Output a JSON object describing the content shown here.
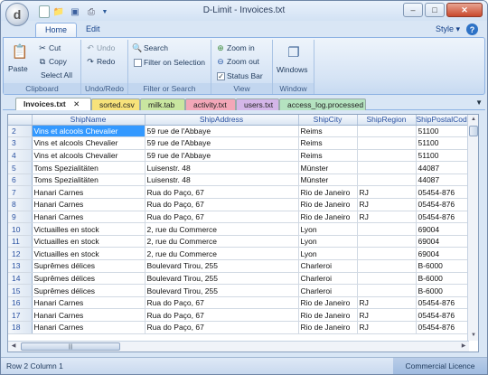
{
  "app": {
    "logo_letter": "d",
    "title": "D-Limit - Invoices.txt"
  },
  "window_controls": {
    "minimize": "–",
    "maximize": "□",
    "close": "✕"
  },
  "ribbon_tabs": {
    "home": "Home",
    "edit": "Edit",
    "style_menu": "Style ▾",
    "help": "?"
  },
  "ribbon": {
    "clipboard": {
      "paste": "Paste",
      "cut": "Cut",
      "copy": "Copy",
      "select_all": "Select All",
      "caption": "Clipboard"
    },
    "undo_redo": {
      "undo": "Undo",
      "redo": "Redo",
      "caption": "Undo/Redo"
    },
    "filter_search": {
      "search": "Search",
      "filter_on_selection": "Filter on Selection",
      "caption": "Filter or Search"
    },
    "view": {
      "zoom_in": "Zoom in",
      "zoom_out": "Zoom out",
      "status_bar": "Status Bar",
      "caption": "View"
    },
    "window": {
      "windows": "Windows",
      "caption": "Window"
    }
  },
  "document_tabs": [
    {
      "label": "Invoices.txt",
      "color": "#ffffff"
    },
    {
      "label": "sorted.csv",
      "color": "#f7e27a"
    },
    {
      "label": "milk.tab",
      "color": "#c9e6a0"
    },
    {
      "label": "activity.txt",
      "color": "#f3a7b8"
    },
    {
      "label": "users.txt",
      "color": "#d4b6e8"
    },
    {
      "label": "access_log.processed",
      "color": "#b5e3c0"
    }
  ],
  "tab_close": "✕",
  "grid": {
    "columns": [
      "ShipName",
      "ShipAddress",
      "ShipCity",
      "ShipRegion",
      "ShipPostalCode"
    ],
    "rows": [
      {
        "n": "2",
        "cells": [
          "Vins et alcools Chevalier",
          "59 rue de l'Abbaye",
          "Reims",
          "",
          "51100"
        ]
      },
      {
        "n": "3",
        "cells": [
          "Vins et alcools Chevalier",
          "59 rue de l'Abbaye",
          "Reims",
          "",
          "51100"
        ]
      },
      {
        "n": "4",
        "cells": [
          "Vins et alcools Chevalier",
          "59 rue de l'Abbaye",
          "Reims",
          "",
          "51100"
        ]
      },
      {
        "n": "5",
        "cells": [
          "Toms Spezialitäten",
          "Luisenstr. 48",
          "Münster",
          "",
          "44087"
        ]
      },
      {
        "n": "6",
        "cells": [
          "Toms Spezialitäten",
          "Luisenstr. 48",
          "Münster",
          "",
          "44087"
        ]
      },
      {
        "n": "7",
        "cells": [
          "Hanari Carnes",
          "Rua do Paço, 67",
          "Rio de Janeiro",
          "RJ",
          "05454-876"
        ]
      },
      {
        "n": "8",
        "cells": [
          "Hanari Carnes",
          "Rua do Paço, 67",
          "Rio de Janeiro",
          "RJ",
          "05454-876"
        ]
      },
      {
        "n": "9",
        "cells": [
          "Hanari Carnes",
          "Rua do Paço, 67",
          "Rio de Janeiro",
          "RJ",
          "05454-876"
        ]
      },
      {
        "n": "10",
        "cells": [
          "Victuailles en stock",
          "2, rue du Commerce",
          "Lyon",
          "",
          "69004"
        ]
      },
      {
        "n": "11",
        "cells": [
          "Victuailles en stock",
          "2, rue du Commerce",
          "Lyon",
          "",
          "69004"
        ]
      },
      {
        "n": "12",
        "cells": [
          "Victuailles en stock",
          "2, rue du Commerce",
          "Lyon",
          "",
          "69004"
        ]
      },
      {
        "n": "13",
        "cells": [
          "Suprêmes délices",
          "Boulevard Tirou, 255",
          "Charleroi",
          "",
          "B-6000"
        ]
      },
      {
        "n": "14",
        "cells": [
          "Suprêmes délices",
          "Boulevard Tirou, 255",
          "Charleroi",
          "",
          "B-6000"
        ]
      },
      {
        "n": "15",
        "cells": [
          "Suprêmes délices",
          "Boulevard Tirou, 255",
          "Charleroi",
          "",
          "B-6000"
        ]
      },
      {
        "n": "16",
        "cells": [
          "Hanari Carnes",
          "Rua do Paço, 67",
          "Rio de Janeiro",
          "RJ",
          "05454-876"
        ]
      },
      {
        "n": "17",
        "cells": [
          "Hanari Carnes",
          "Rua do Paço, 67",
          "Rio de Janeiro",
          "RJ",
          "05454-876"
        ]
      },
      {
        "n": "18",
        "cells": [
          "Hanari Carnes",
          "Rua do Paço, 67",
          "Rio de Janeiro",
          "RJ",
          "05454-876"
        ]
      }
    ]
  },
  "status": {
    "position": "Row 2 Column 1",
    "license": "Commercial Licence"
  }
}
